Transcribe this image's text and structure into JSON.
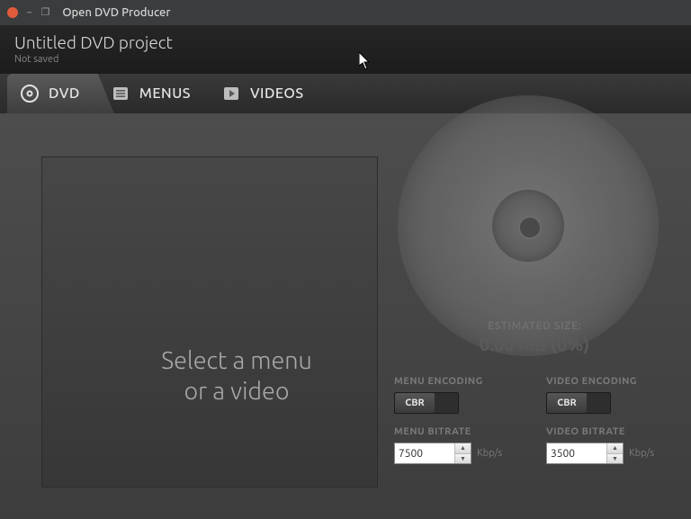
{
  "window": {
    "title": "Open DVD Producer"
  },
  "project": {
    "title": "Untitled DVD project",
    "status": "Not saved"
  },
  "tabs": {
    "dvd": "DVD",
    "menus": "MENUS",
    "videos": "VIDEOS"
  },
  "preview": {
    "line1": "Select a menu",
    "line2": "or a video"
  },
  "estimate": {
    "label": "ESTIMATED SIZE:",
    "value": "0.00 MB (0%)"
  },
  "encoding": {
    "menu_label": "MENU ENCODING",
    "video_label": "VIDEO ENCODING",
    "mode": "CBR"
  },
  "bitrate": {
    "menu_label": "MENU BITRATE",
    "video_label": "VIDEO BITRATE",
    "menu_value": "7500",
    "video_value": "3500",
    "unit": "Kbp/s"
  }
}
